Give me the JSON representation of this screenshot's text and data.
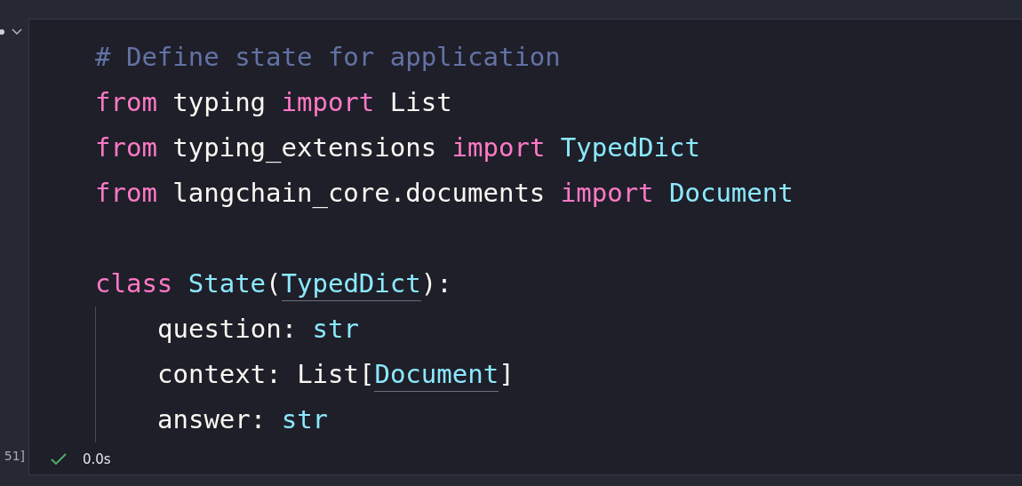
{
  "cell": {
    "execution_count": "51]",
    "status": "0.0s",
    "succeeded": true,
    "lines": [
      {
        "kind": "code",
        "indented": false,
        "tokens": [
          {
            "text": "# Define state for application",
            "kind": "comment"
          }
        ]
      },
      {
        "kind": "code",
        "indented": false,
        "tokens": [
          {
            "text": "from",
            "kind": "keyword"
          },
          {
            "text": " typing ",
            "kind": "plain"
          },
          {
            "text": "import",
            "kind": "keyword"
          },
          {
            "text": " List",
            "kind": "plain"
          }
        ]
      },
      {
        "kind": "code",
        "indented": false,
        "tokens": [
          {
            "text": "from",
            "kind": "keyword"
          },
          {
            "text": " typing_extensions ",
            "kind": "plain"
          },
          {
            "text": "import ",
            "kind": "keyword"
          },
          {
            "text": "TypedDict",
            "kind": "type"
          }
        ]
      },
      {
        "kind": "code",
        "indented": false,
        "tokens": [
          {
            "text": "from",
            "kind": "keyword"
          },
          {
            "text": " langchain_core.documents ",
            "kind": "plain"
          },
          {
            "text": "import ",
            "kind": "keyword"
          },
          {
            "text": "Document",
            "kind": "type"
          }
        ]
      },
      {
        "kind": "blank"
      },
      {
        "kind": "code",
        "indented": false,
        "tokens": [
          {
            "text": "class ",
            "kind": "keyword"
          },
          {
            "text": "State",
            "kind": "type"
          },
          {
            "text": "(",
            "kind": "plain"
          },
          {
            "text": "TypedDict",
            "kind": "type",
            "underlined": true
          },
          {
            "text": "):",
            "kind": "plain"
          }
        ]
      },
      {
        "kind": "code",
        "indented": true,
        "tokens": [
          {
            "text": "question: ",
            "kind": "plain"
          },
          {
            "text": "str",
            "kind": "type"
          }
        ]
      },
      {
        "kind": "code",
        "indented": true,
        "tokens": [
          {
            "text": "context: List[",
            "kind": "plain"
          },
          {
            "text": "Document",
            "kind": "type",
            "underlined": true
          },
          {
            "text": "]",
            "kind": "plain"
          }
        ]
      },
      {
        "kind": "code",
        "indented": true,
        "tokens": [
          {
            "text": "answer: ",
            "kind": "plain"
          },
          {
            "text": "str",
            "kind": "type"
          }
        ]
      }
    ]
  }
}
